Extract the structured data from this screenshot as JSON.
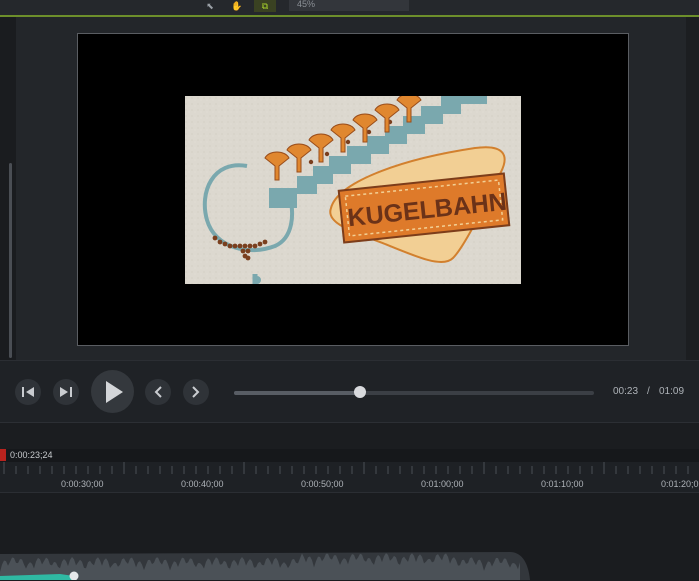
{
  "toolbar": {
    "tools": [
      {
        "name": "pointer-icon",
        "glyph": "⬉"
      },
      {
        "name": "hand-icon",
        "glyph": "✋"
      },
      {
        "name": "crop-icon",
        "glyph": "⧉"
      }
    ],
    "zoom_label": "45%"
  },
  "video": {
    "logo_text": "KUGELBAHN"
  },
  "player": {
    "current_time": "00:23",
    "separator": "/",
    "total_time": "01:09",
    "progress": 0.35
  },
  "timeline": {
    "playhead_time": "0:00:23;24",
    "labels": [
      "0:00:30;00",
      "0:00:40;00",
      "0:00:50;00",
      "0:01:00;00",
      "0:01:10;00",
      "0:01:20;0"
    ]
  },
  "colors": {
    "accent_green": "#a6d12c",
    "playhead_red": "#b8231e",
    "audio_clip": "#4b5157",
    "audio_volume_line": "#2fb9a3"
  }
}
